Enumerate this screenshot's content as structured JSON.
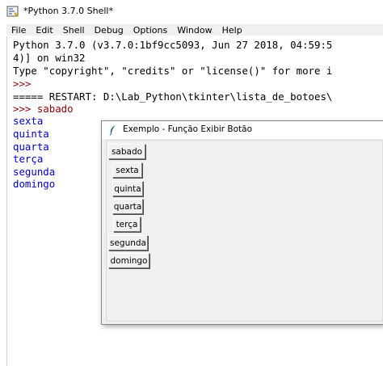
{
  "shell": {
    "title": "*Python 3.7.0 Shell*",
    "menu": [
      "File",
      "Edit",
      "Shell",
      "Debug",
      "Options",
      "Window",
      "Help"
    ],
    "lines": [
      "Python 3.7.0 (v3.7.0:1bf9cc5093, Jun 27 2018, 04:59:5",
      "4)] on win32",
      "Type \"copyright\", \"credits\" or \"license()\" for more i",
      ">>> ",
      "===== RESTART: D:\\Lab_Python\\tkinter\\lista_de_botoes\\",
      ">>> sabado",
      "sexta",
      "quinta",
      "quarta",
      "terça",
      "segunda",
      "domingo"
    ]
  },
  "tk_window": {
    "title": "Exemplo - Função Exibir Botão",
    "buttons": [
      "sabado",
      "sexta",
      "quinta",
      "quarta",
      "terça",
      "segunda",
      "domingo"
    ]
  }
}
